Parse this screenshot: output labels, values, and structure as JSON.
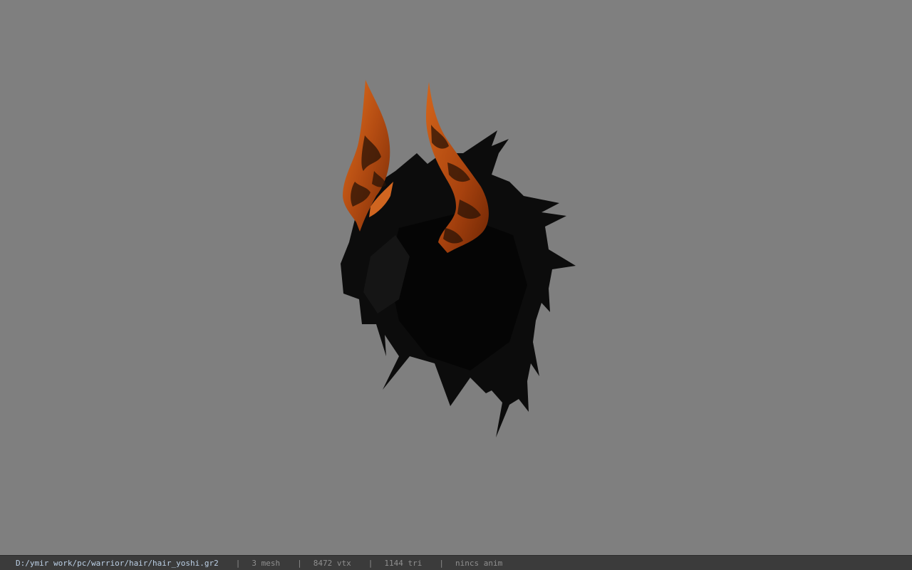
{
  "viewport": {
    "background_color": "#7f7f7f",
    "model": {
      "subject": "hair-mesh-with-horns",
      "hair_color": "#0b0b0b",
      "horn_color": "#c45a18",
      "horn_dark_color": "#2a1306"
    }
  },
  "status_bar": {
    "file_path": "D:/ymir work/pc/warrior/hair/hair_yoshi.gr2",
    "separator": "|",
    "mesh_count": "3 mesh",
    "vertex_count": "8472 vtx",
    "triangle_count": "1144 tri",
    "anim_status": "nincs anim",
    "colors": {
      "background": "#3b3b3b",
      "path_text": "#bcd0e6",
      "info_text": "#8f8f8f"
    }
  }
}
